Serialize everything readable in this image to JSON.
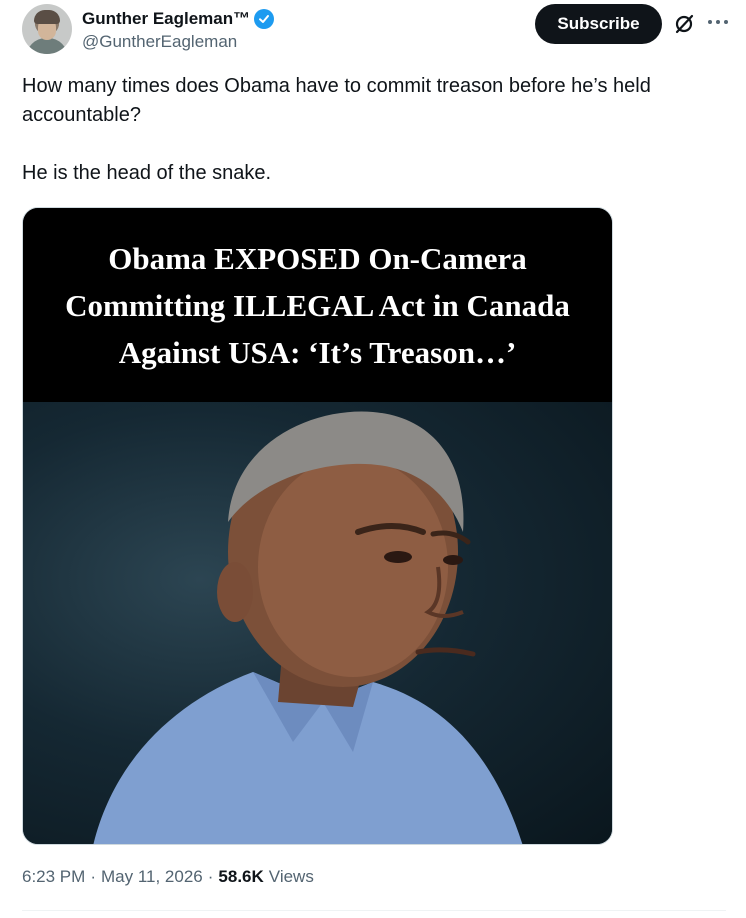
{
  "author": {
    "display_name": "Gunther Eagleman™",
    "handle": "@GuntherEagleman",
    "verified": true
  },
  "actions": {
    "subscribe_label": "Subscribe",
    "grok_icon": "grok-slash-icon",
    "more_icon": "more-horizontal-icon"
  },
  "tweet": {
    "line1": "How many times does Obama have to commit treason before he’s held accountable?",
    "line2": "He is the head of the snake."
  },
  "media": {
    "headline_line1": "Obama EXPOSED On-Camera",
    "headline_line2": "Committing ILLEGAL Act in Canada",
    "headline_line3": "Against USA: ‘It’s Treason…’"
  },
  "meta": {
    "time": "6:23 PM",
    "date": "May 11, 2026",
    "views_count": "58.6K",
    "views_label": "Views",
    "separator": "·"
  },
  "colors": {
    "accent_verified": "#1d9bf0",
    "subscribe_bg": "#0f1419",
    "secondary_text": "#536471"
  }
}
